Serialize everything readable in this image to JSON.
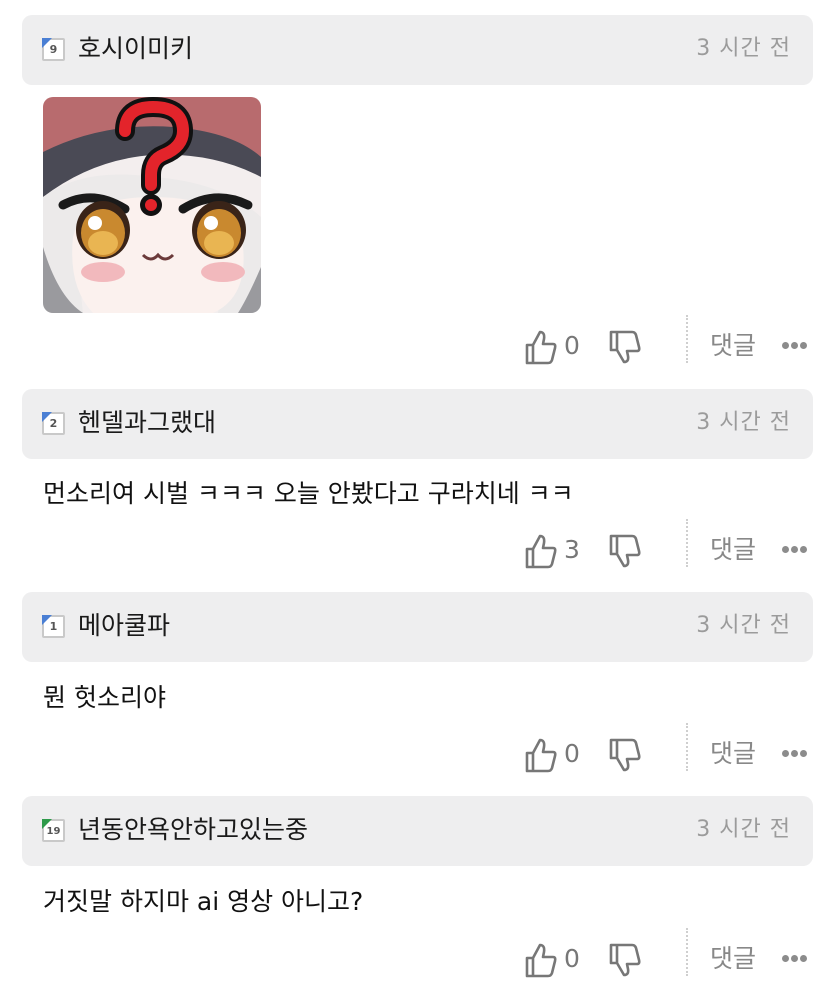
{
  "comments": [
    {
      "level": "9",
      "username": "호시이미키",
      "time": "3 시간 전",
      "text": "",
      "image": "chibi-question-mark-sticker",
      "likes": "0",
      "reply_label": "댓글"
    },
    {
      "level": "2",
      "username": "헨델과그랬대",
      "time": "3 시간 전",
      "text": "먼소리여 시벌 ㅋㅋㅋ 오늘 안봤다고 구라치네 ㅋㅋ",
      "likes": "3",
      "reply_label": "댓글"
    },
    {
      "level": "1",
      "username": "메아쿨파",
      "time": "3 시간 전",
      "text": "뭔 헛소리야",
      "likes": "0",
      "reply_label": "댓글"
    },
    {
      "level": "19",
      "username": "년동안욕안하고있는중",
      "time": "3 시간 전",
      "text": "거짓말 하지마 ai 영상 아니고?",
      "likes": "0",
      "reply_label": "댓글"
    }
  ],
  "icons": {
    "like": "thumbs-up-icon",
    "dislike": "thumbs-down-icon",
    "more": "more-dots-icon"
  },
  "colors": {
    "header_bg": "#eeeeef",
    "time_text": "#9b9b9b",
    "level_blue": "#4a7fd4",
    "level_green": "#2e9a4a"
  }
}
